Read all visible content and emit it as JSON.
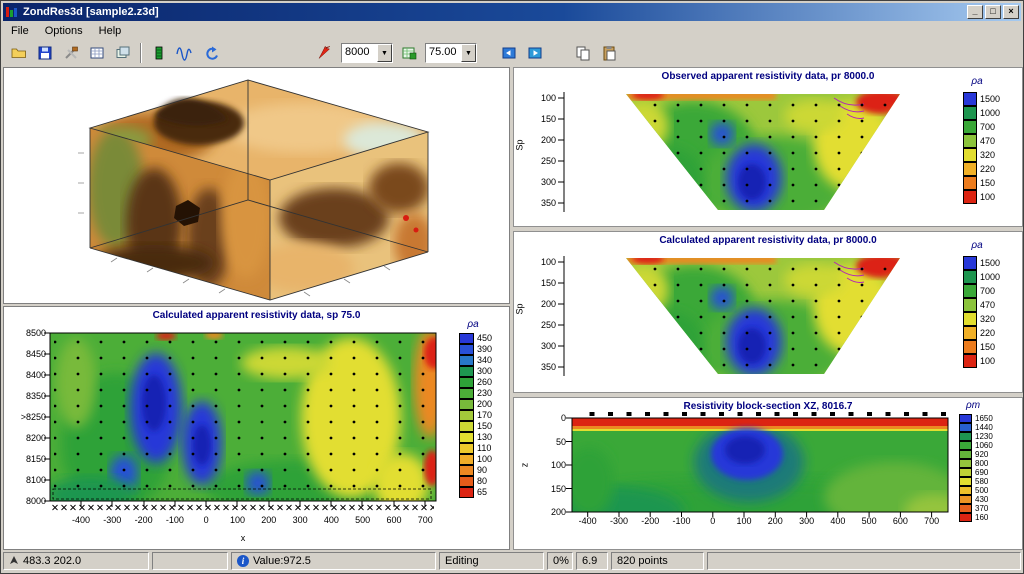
{
  "window": {
    "title": "ZondRes3d [sample2.z3d]",
    "buttons": {
      "minimize": "_",
      "maximize": "□",
      "close": "×"
    }
  },
  "menu": {
    "items": [
      "File",
      "Options",
      "Help"
    ]
  },
  "icons": {
    "dropdown": "▼"
  },
  "toolbar": {
    "pr_select": {
      "value": "8000"
    },
    "sp_select": {
      "value": "75.00"
    }
  },
  "chart_data": [
    {
      "id": "observed-pseudosection",
      "type": "contour",
      "title": "Observed apparent resistivity data, pr 8000.0",
      "ylabel": "Sp",
      "yticks": [
        "100",
        "150",
        "200",
        "250",
        "300",
        "350"
      ],
      "colorbar": {
        "label": "ρa",
        "ticks": [
          "1500",
          "1000",
          "700",
          "470",
          "320",
          "220",
          "150",
          "100"
        ],
        "colors": [
          "#2838d8",
          "#1e9650",
          "#3aa838",
          "#8cc43c",
          "#e2de30",
          "#f0b028",
          "#ec7c1e",
          "#dc2412"
        ]
      }
    },
    {
      "id": "calculated-pseudosection",
      "type": "contour",
      "title": "Calculated apparent resistivity data, pr 8000.0",
      "ylabel": "Sp",
      "yticks": [
        "100",
        "150",
        "200",
        "250",
        "300",
        "350"
      ],
      "colorbar": {
        "label": "ρa",
        "ticks": [
          "1500",
          "1000",
          "700",
          "470",
          "320",
          "220",
          "150",
          "100"
        ],
        "colors": [
          "#2838d8",
          "#1e9650",
          "#3aa838",
          "#8cc43c",
          "#e2de30",
          "#f0b028",
          "#ec7c1e",
          "#dc2412"
        ]
      }
    },
    {
      "id": "calculated-plan-map",
      "type": "contour",
      "title": "Calculated  apparent resistivity data, sp 75.0",
      "xlabel": "x",
      "yticks": [
        "8500",
        "8450",
        "8400",
        "8350",
        ">8250",
        "8200",
        "8150",
        "8100",
        "8000"
      ],
      "xticks": [
        "-400",
        "-300",
        "-200",
        "-100",
        "0",
        "100",
        "200",
        "300",
        "400",
        "500",
        "600",
        "700"
      ],
      "colorbar": {
        "label": "ρa",
        "ticks": [
          "450",
          "390",
          "340",
          "300",
          "260",
          "230",
          "200",
          "170",
          "150",
          "130",
          "110",
          "100",
          "90",
          "80",
          "65"
        ],
        "colors": [
          "#2838d8",
          "#2850d8",
          "#2878c8",
          "#1e9650",
          "#2ea238",
          "#4cae38",
          "#78ba3a",
          "#a4ca3a",
          "#ccd834",
          "#e2de30",
          "#ecc82c",
          "#f0ac28",
          "#ec8822",
          "#e65c1a",
          "#dc2412"
        ]
      }
    },
    {
      "id": "resistivity-block-section",
      "type": "section",
      "title": "Resistivity block-section XZ, 8016.7",
      "ylabel": "z",
      "yticks": [
        "0",
        "50",
        "100",
        "150",
        "200"
      ],
      "xticks": [
        "-400",
        "-300",
        "-200",
        "-100",
        "0",
        "100",
        "200",
        "300",
        "400",
        "500",
        "600",
        "700"
      ],
      "colorbar": {
        "label": "ρm",
        "ticks": [
          "1650",
          "1440",
          "1230",
          "1060",
          "920",
          "800",
          "690",
          "580",
          "500",
          "430",
          "370",
          "160"
        ],
        "colors": [
          "#2838d8",
          "#2860d0",
          "#1e9650",
          "#3aa838",
          "#64b43a",
          "#94c43c",
          "#c0d236",
          "#e2de30",
          "#eec02a",
          "#ec9424",
          "#e6601c",
          "#dc2412"
        ]
      }
    }
  ],
  "statusbar": {
    "coordinates": "483.3 202.0",
    "value": "Value:972.5",
    "mode": "Editing",
    "progress": "0%",
    "scale": "6.9",
    "points": "820 points"
  }
}
